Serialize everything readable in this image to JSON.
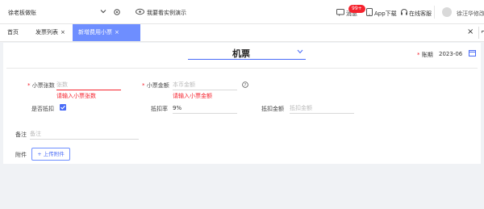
{
  "header": {
    "org_name": "徐老板做账",
    "demo_label": "我要看实例演示",
    "message_label": "消息",
    "message_badge": "99+",
    "app_download_label": "App下载",
    "online_service_label": "在线客服",
    "user_name": "徐汪华修改"
  },
  "tabs": [
    {
      "label": "首页",
      "closable": false,
      "active": false
    },
    {
      "label": "发票列表",
      "closable": true,
      "active": false
    },
    {
      "label": "新增费用小票",
      "closable": true,
      "active": true
    }
  ],
  "tab_close_symbol": "×",
  "form": {
    "title": "机票",
    "period_label": "账期",
    "period_value": "2023-06",
    "fields": {
      "count_label": "小票张数",
      "count_placeholder": "张数",
      "count_error": "请输入小票张数",
      "amount_label": "小票金额",
      "amount_placeholder": "本币金额",
      "amount_error": "请输入小票金额",
      "deduct_label": "是否抵扣",
      "deduct_checked": true,
      "rate_label": "抵扣率",
      "rate_value": "9%",
      "deduct_amount_label": "抵扣金额",
      "deduct_amount_placeholder": "抵扣金额",
      "note_label": "备注",
      "note_placeholder": "备注",
      "attach_label": "附件",
      "upload_label": "+ 上传附件"
    },
    "required_mark": "*"
  },
  "colors": {
    "accent": "#4a6cf7",
    "active_tab": "#6e8eff",
    "error": "#f5222d"
  }
}
